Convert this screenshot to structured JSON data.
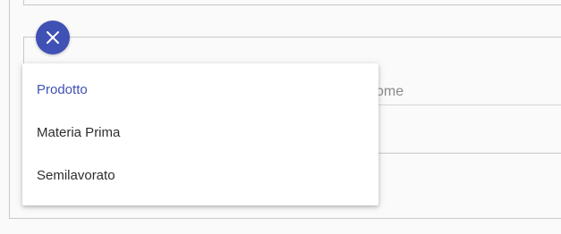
{
  "form": {
    "name_placeholder": "ome"
  },
  "fab": {
    "icon": "close-icon",
    "color": "#3f51b5"
  },
  "dropdown": {
    "selected": "Prodotto",
    "accent_color": "#3f51b5",
    "options": [
      {
        "label": "Prodotto",
        "selected": true
      },
      {
        "label": "Materia Prima",
        "selected": false
      },
      {
        "label": "Semilavorato",
        "selected": false
      }
    ]
  }
}
